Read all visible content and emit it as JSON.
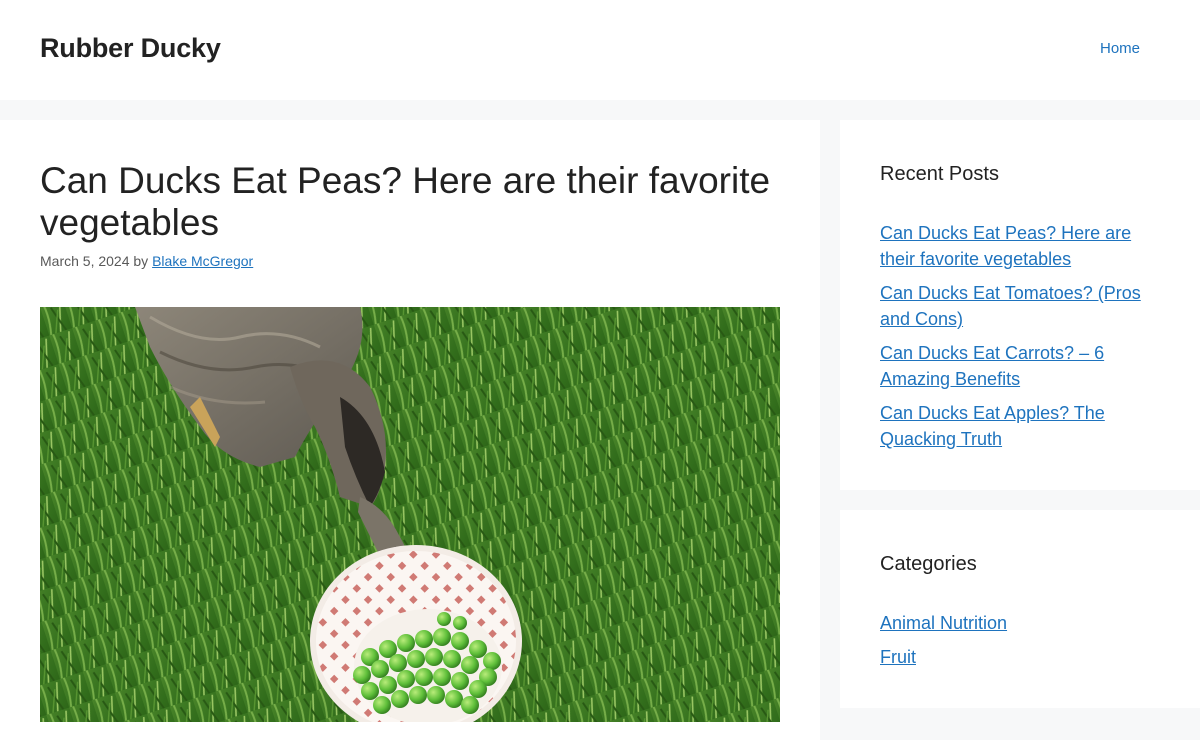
{
  "header": {
    "site_title": "Rubber Ducky",
    "nav": {
      "home_label": "Home"
    }
  },
  "post": {
    "title": "Can Ducks Eat Peas? Here are their favorite vegetables",
    "date": "March 5, 2024",
    "by_label": "by",
    "author": "Blake McGregor"
  },
  "sidebar": {
    "recent_posts": {
      "title": "Recent Posts",
      "items": [
        {
          "label": "Can Ducks Eat Peas? Here are their favorite vegetables"
        },
        {
          "label": "Can Ducks Eat Tomatoes? (Pros and Cons)"
        },
        {
          "label": "Can Ducks Eat Carrots? – 6 Amazing Benefits"
        },
        {
          "label": "Can Ducks Eat Apples? The Quacking Truth"
        }
      ]
    },
    "categories": {
      "title": "Categories",
      "items": [
        {
          "label": "Animal Nutrition"
        },
        {
          "label": "Fruit"
        }
      ]
    }
  },
  "colors": {
    "link": "#1e73be",
    "text": "#222222",
    "meta": "#595959",
    "page_bg": "#f7f8f9"
  }
}
